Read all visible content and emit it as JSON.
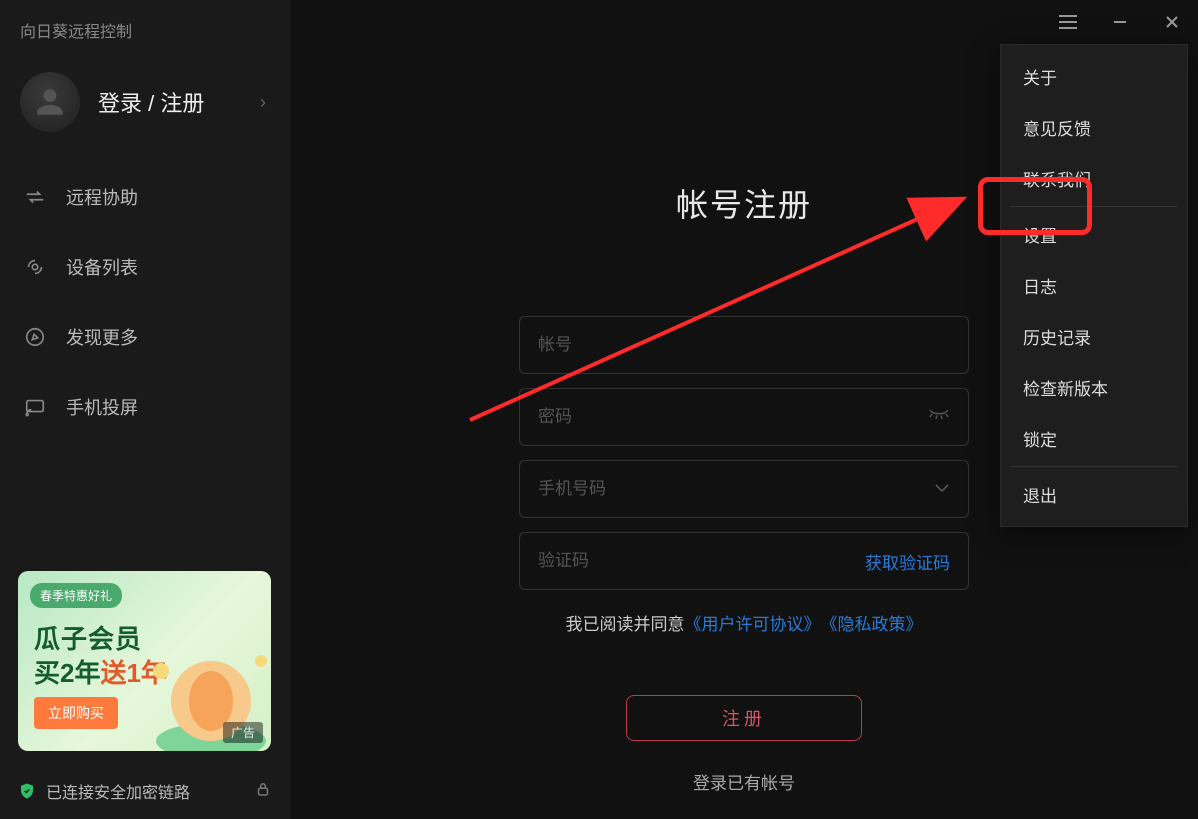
{
  "app": {
    "title": "向日葵远程控制"
  },
  "profile": {
    "label": "登录 / 注册"
  },
  "nav": {
    "remote": "远程协助",
    "devices": "设备列表",
    "discover": "发现更多",
    "cast": "手机投屏"
  },
  "ad": {
    "badge": "春季特惠好礼",
    "line1": "瓜子会员",
    "line2_a": "买2年",
    "line2_b": "送1年",
    "buy": "立即购买",
    "tag": "广告"
  },
  "status": {
    "text": "已连接安全加密链路"
  },
  "register": {
    "title": "帐号注册",
    "account_ph": "帐号",
    "password_ph": "密码",
    "phone_ph": "手机号码",
    "code_ph": "验证码",
    "get_code": "获取验证码",
    "agree_prefix": "我已阅读并同意",
    "agreement": "《用户许可协议》",
    "privacy": "《隐私政策》",
    "button": "注册",
    "have_account": "登录已有帐号"
  },
  "menu": {
    "about": "关于",
    "feedback": "意见反馈",
    "contact": "联系我们",
    "settings": "设置",
    "log": "日志",
    "history": "历史记录",
    "update": "检查新版本",
    "lock": "锁定",
    "exit": "退出"
  }
}
